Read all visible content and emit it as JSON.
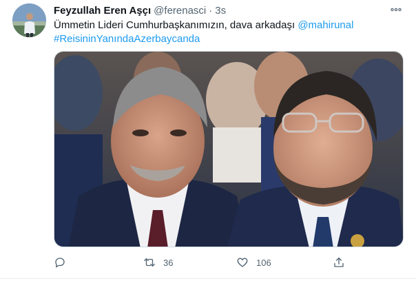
{
  "tweet": {
    "author_name": "Feyzullah Eren Aşçı",
    "author_handle": "@ferenasci",
    "separator": "·",
    "time": "3s",
    "text_main": "Ümmetin Lideri Cumhurbaşkanımızın, dava arkadaşı ",
    "mention": "@mahirunal",
    "hashtag": "#ReisininYanındaAzerbaycanda",
    "photo_alt": "photo"
  },
  "actions": {
    "reply_icon": "reply-icon",
    "retweet_icon": "retweet-icon",
    "retweet_count": "36",
    "like_icon": "heart-icon",
    "like_count": "106",
    "share_icon": "share-icon"
  },
  "colors": {
    "link": "#1d9bf0",
    "muted": "#536471",
    "text": "#0f1419"
  }
}
